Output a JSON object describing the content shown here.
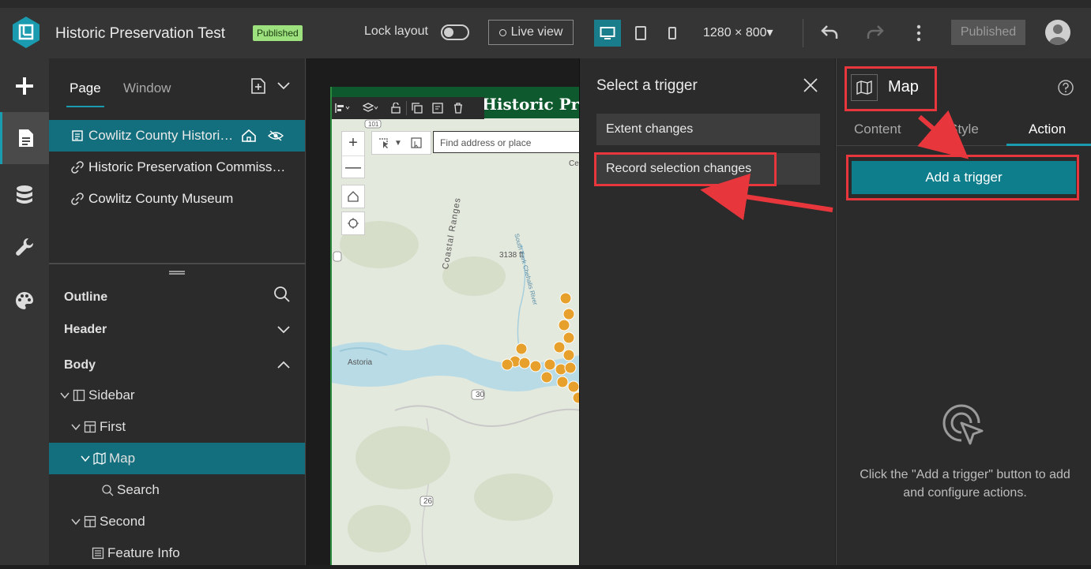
{
  "header": {
    "app_title": "Historic Preservation Test",
    "status_badge": "Published",
    "lock_layout_label": "Lock layout",
    "live_view_label": "Live view",
    "resolution": "1280 × 800",
    "publish_button": "Published"
  },
  "colors": {
    "accent": "#1a9bb0",
    "selected_row": "#136f7d",
    "primary_button": "#0e7d8c",
    "badge_green": "#9de07e",
    "annotation_red": "#e8363d"
  },
  "left_rail": {
    "items": [
      "add-icon",
      "page-icon",
      "data-icon",
      "tools-icon",
      "theme-icon"
    ]
  },
  "page_panel": {
    "tabs": [
      "Page",
      "Window"
    ],
    "pages": [
      {
        "label": "Cowlitz County Histori…",
        "icon": "page-icon"
      },
      {
        "label": "Historic Preservation Commiss…",
        "icon": "link-icon"
      },
      {
        "label": "Cowlitz County Museum",
        "icon": "link-icon"
      }
    ],
    "outline_label": "Outline",
    "sections": {
      "header": "Header",
      "body": "Body"
    },
    "tree": [
      {
        "label": "Sidebar"
      },
      {
        "label": "First"
      },
      {
        "label": "Map"
      },
      {
        "label": "Search"
      },
      {
        "label": "Second"
      },
      {
        "label": "Feature Info"
      }
    ]
  },
  "canvas": {
    "map_title": "Historic Pre",
    "search_placeholder": "Find address or place",
    "labels": {
      "coastal_ranges": "Coastal Ranges",
      "elevation": "3138 ft",
      "astoria": "Astoria",
      "river": "South Fork Chehalis River",
      "route_30": "30",
      "route_26": "26",
      "route_101": "101",
      "cent": "Cen"
    }
  },
  "trigger_panel": {
    "title": "Select a trigger",
    "options": [
      "Extent changes",
      "Record selection changes"
    ]
  },
  "settings_panel": {
    "widget_name": "Map",
    "tabs": [
      "Content",
      "Style",
      "Action"
    ],
    "active_tab": "Action",
    "add_trigger_label": "Add a trigger",
    "empty_message": "Click the \"Add a trigger\" button to add and configure actions."
  }
}
